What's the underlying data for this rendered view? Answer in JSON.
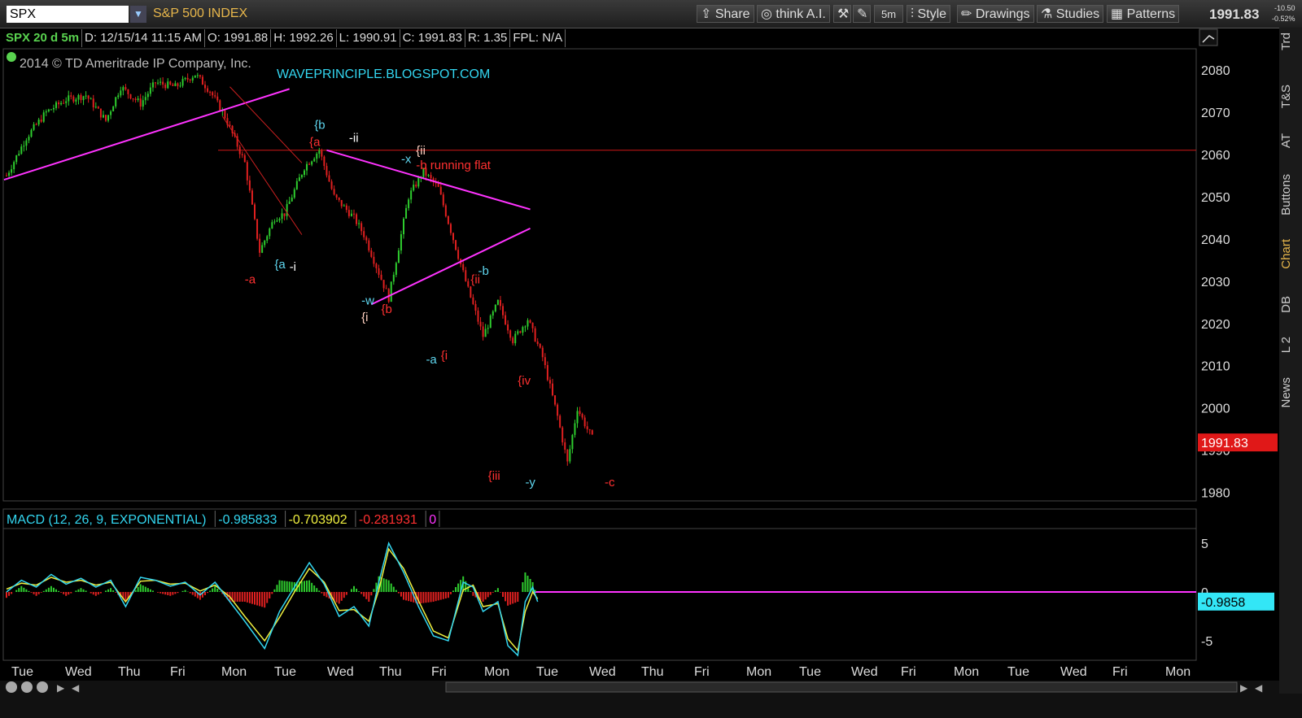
{
  "toolbar": {
    "symbol": "SPX",
    "symbol_name": "S&P 500 INDEX",
    "share": "Share",
    "think_ai": "think A.I.",
    "interval": "5m",
    "style": "Style",
    "drawings": "Drawings",
    "studies": "Studies",
    "patterns": "Patterns",
    "last_price": "1991.83",
    "change": "-10.50",
    "change_pct": "-0.52%"
  },
  "info": {
    "symbol_period": "SPX 20 d 5m",
    "date": "D: 12/15/14 11:15 AM",
    "open": "O: 1991.88",
    "high": "H: 1992.26",
    "low": "L: 1990.91",
    "close": "C: 1991.83",
    "range": "R: 1.35",
    "fpl": "FPL: N/A"
  },
  "copyright": "2014 © TD Ameritrade IP Company, Inc.",
  "watermark": "WAVEPRINCIPLE.BLOGSPOT.COM",
  "side_tabs": [
    "Trd",
    "T&S",
    "AT",
    "Buttons",
    "Chart",
    "DB",
    "L 2",
    "News"
  ],
  "chart_data": [
    {
      "type": "candlestick",
      "price_label": "1991.83",
      "yticks": [
        2080,
        2070,
        2060,
        2050,
        2040,
        2030,
        2020,
        2010,
        2000,
        1990,
        1980
      ],
      "ylim": [
        1978,
        2085
      ],
      "x_labels": [
        "Tue",
        "Wed",
        "Thu",
        "Fri",
        "Mon",
        "Tue",
        "Wed",
        "Thu",
        "Fri",
        "Mon",
        "Tue",
        "Wed",
        "Thu",
        "Fri",
        "Mon",
        "Tue",
        "Wed",
        "Fri",
        "Mon",
        "Tue",
        "Wed",
        "Fri",
        "Mon"
      ],
      "horizontal_line": 2061,
      "price_path": [
        [
          0,
          2055
        ],
        [
          0.4,
          2064
        ],
        [
          0.8,
          2070
        ],
        [
          1.2,
          2073
        ],
        [
          1.6,
          2074
        ],
        [
          2.0,
          2068
        ],
        [
          2.3,
          2076
        ],
        [
          2.7,
          2072
        ],
        [
          3.0,
          2077
        ],
        [
          3.4,
          2076
        ],
        [
          3.8,
          2079
        ],
        [
          4.1,
          2075
        ],
        [
          4.4,
          2069
        ],
        [
          4.8,
          2058
        ],
        [
          5.1,
          2037
        ],
        [
          5.4,
          2045
        ],
        [
          5.6,
          2046
        ],
        [
          6.0,
          2057
        ],
        [
          6.3,
          2061
        ],
        [
          6.6,
          2050
        ],
        [
          7.0,
          2045
        ],
        [
          7.2,
          2041
        ],
        [
          7.5,
          2032
        ],
        [
          7.7,
          2026
        ],
        [
          8.1,
          2050
        ],
        [
          8.4,
          2056
        ],
        [
          8.7,
          2052
        ],
        [
          9.0,
          2040
        ],
        [
          9.3,
          2028
        ],
        [
          9.6,
          2017
        ],
        [
          9.9,
          2025
        ],
        [
          10.2,
          2016
        ],
        [
          10.5,
          2021
        ],
        [
          10.8,
          2012
        ],
        [
          11.1,
          1998
        ],
        [
          11.3,
          1987
        ],
        [
          11.5,
          2000
        ],
        [
          11.7,
          1995
        ],
        [
          11.85,
          1991.83
        ]
      ],
      "wave_labels": [
        {
          "text": "{b",
          "x": 6.2,
          "y": 2066,
          "color": "#5fd7f0"
        },
        {
          "text": "-ii",
          "x": 6.9,
          "y": 2063,
          "color": "#ffffff"
        },
        {
          "text": "{a",
          "x": 6.1,
          "y": 2062,
          "color": "#ff3030"
        },
        {
          "text": "{ii",
          "x": 8.25,
          "y": 2060,
          "color": "#ffd0c0"
        },
        {
          "text": "-x",
          "x": 7.95,
          "y": 2058,
          "color": "#5fd7f0"
        },
        {
          "text": "-b running flat",
          "x": 8.25,
          "y": 2056.5,
          "color": "#ff3030"
        },
        {
          "text": "{a",
          "x": 5.4,
          "y": 2033,
          "color": "#5fd7f0"
        },
        {
          "text": "-i",
          "x": 5.7,
          "y": 2032.5,
          "color": "#ffffff"
        },
        {
          "text": "-a",
          "x": 4.8,
          "y": 2029.5,
          "color": "#ff3030"
        },
        {
          "text": "-w",
          "x": 7.15,
          "y": 2024.5,
          "color": "#5fd7f0"
        },
        {
          "text": "{i",
          "x": 7.15,
          "y": 2020.5,
          "color": "#ffd0c0"
        },
        {
          "text": "{b",
          "x": 7.55,
          "y": 2022.5,
          "color": "#ff3030"
        },
        {
          "text": "-b",
          "x": 9.5,
          "y": 2031.5,
          "color": "#5fd7f0"
        },
        {
          "text": "{ii",
          "x": 9.35,
          "y": 2029.5,
          "color": "#ff3030"
        },
        {
          "text": "-a",
          "x": 8.45,
          "y": 2010.5,
          "color": "#5fd7f0"
        },
        {
          "text": "{i",
          "x": 8.75,
          "y": 2011.5,
          "color": "#ff3030"
        },
        {
          "text": "{iv",
          "x": 10.3,
          "y": 2005.5,
          "color": "#ff3030"
        },
        {
          "text": "{iii",
          "x": 9.7,
          "y": 1983,
          "color": "#ff3030"
        },
        {
          "text": "-y",
          "x": 10.45,
          "y": 1981.5,
          "color": "#5fd7f0"
        },
        {
          "text": "-c",
          "x": 12.05,
          "y": 1981.5,
          "color": "#ff3030"
        }
      ]
    },
    {
      "type": "macd",
      "title": "MACD (12, 26, 9, EXPONENTIAL)",
      "value": "-0.985833",
      "avg": "-0.703902",
      "diff": "-0.281931",
      "zero_label": "0",
      "price_label": "-0.9858",
      "yticks": [
        5,
        0,
        -5
      ],
      "ylim": [
        -7,
        6.5
      ],
      "value_path": [
        [
          0,
          0
        ],
        [
          0.3,
          1.2
        ],
        [
          0.6,
          0.5
        ],
        [
          0.9,
          1.8
        ],
        [
          1.2,
          0.8
        ],
        [
          1.5,
          1.4
        ],
        [
          1.8,
          0.5
        ],
        [
          2.1,
          1.2
        ],
        [
          2.4,
          -1.5
        ],
        [
          2.7,
          1.5
        ],
        [
          3.0,
          1.2
        ],
        [
          3.3,
          0.6
        ],
        [
          3.6,
          1.0
        ],
        [
          3.9,
          -0.3
        ],
        [
          4.2,
          1.0
        ],
        [
          4.5,
          -1.0
        ],
        [
          4.8,
          -3.0
        ],
        [
          5.2,
          -5.8
        ],
        [
          5.5,
          -2.0
        ],
        [
          5.8,
          0.5
        ],
        [
          6.1,
          3.0
        ],
        [
          6.4,
          0.8
        ],
        [
          6.7,
          -2.5
        ],
        [
          7.0,
          -1.5
        ],
        [
          7.3,
          -3.5
        ],
        [
          7.5,
          1.0
        ],
        [
          7.7,
          5.0
        ],
        [
          8.0,
          2.0
        ],
        [
          8.3,
          -1.5
        ],
        [
          8.6,
          -4.5
        ],
        [
          8.9,
          -5.0
        ],
        [
          9.2,
          1.0
        ],
        [
          9.4,
          0.5
        ],
        [
          9.6,
          -2.0
        ],
        [
          9.9,
          -1.0
        ],
        [
          10.1,
          -5.5
        ],
        [
          10.3,
          -6.5
        ],
        [
          10.45,
          -1.0
        ],
        [
          10.6,
          0.5
        ],
        [
          10.7,
          -1.0
        ]
      ],
      "avg_path": [
        [
          0,
          0.3
        ],
        [
          0.3,
          0.9
        ],
        [
          0.6,
          0.7
        ],
        [
          0.9,
          1.5
        ],
        [
          1.2,
          1.0
        ],
        [
          1.5,
          1.2
        ],
        [
          1.8,
          0.7
        ],
        [
          2.1,
          1.0
        ],
        [
          2.4,
          -1.0
        ],
        [
          2.7,
          1.1
        ],
        [
          3.0,
          1.2
        ],
        [
          3.3,
          0.8
        ],
        [
          3.6,
          0.9
        ],
        [
          3.9,
          0.1
        ],
        [
          4.2,
          0.7
        ],
        [
          4.5,
          -0.5
        ],
        [
          4.8,
          -2.5
        ],
        [
          5.2,
          -5.0
        ],
        [
          5.5,
          -2.6
        ],
        [
          5.8,
          0.0
        ],
        [
          6.1,
          2.4
        ],
        [
          6.4,
          1.0
        ],
        [
          6.7,
          -1.9
        ],
        [
          7.0,
          -1.8
        ],
        [
          7.3,
          -3.0
        ],
        [
          7.5,
          0.2
        ],
        [
          7.7,
          4.4
        ],
        [
          8.0,
          2.4
        ],
        [
          8.3,
          -0.9
        ],
        [
          8.6,
          -4.0
        ],
        [
          8.9,
          -4.7
        ],
        [
          9.2,
          0.2
        ],
        [
          9.4,
          0.7
        ],
        [
          9.6,
          -1.5
        ],
        [
          9.9,
          -1.2
        ],
        [
          10.1,
          -4.8
        ],
        [
          10.3,
          -6.0
        ],
        [
          10.45,
          -2.0
        ],
        [
          10.6,
          0.0
        ],
        [
          10.7,
          -0.7
        ]
      ]
    }
  ]
}
